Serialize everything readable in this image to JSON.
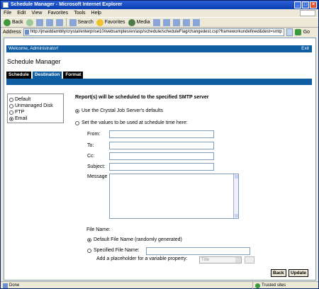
{
  "window": {
    "title": "Schedule Manager - Microsoft Internet Explorer"
  },
  "menu": [
    "File",
    "Edit",
    "View",
    "Favorites",
    "Tools",
    "Help"
  ],
  "toolbar": {
    "back": "Back",
    "search": "Search",
    "favorites": "Favorites",
    "media": "Media"
  },
  "address": {
    "label": "Address",
    "url": "http://jmaiddamblly/crystal/enterprise10/websamples/en/asp/schedule/scheduleFlag/changedest.csp?frameworkundefined&dest=smtp",
    "go": "Go"
  },
  "page": {
    "welcome": "Welcome, Administrator!",
    "exit": "Exit",
    "title": "Schedule Manager",
    "tabs": [
      "Schedule",
      "Destination",
      "Format"
    ]
  },
  "destinations": [
    {
      "label": "Default",
      "selected": false
    },
    {
      "label": "Unmanaged Disk",
      "selected": false
    },
    {
      "label": "FTP",
      "selected": false
    },
    {
      "label": "Email",
      "selected": true
    }
  ],
  "form": {
    "heading": "Report(s) will be scheduled to the specified SMTP server",
    "opt_defaults": "Use the Crystal Job Server's defaults",
    "opt_custom": "Set the values to be used at schedule time here:",
    "from": "From:",
    "to": "To:",
    "cc": "Cc:",
    "subject": "Subject:",
    "message": "Message",
    "file_name": "File Name:",
    "fn_default": "Default File Name (randomly generated)",
    "fn_specified": "Specified File Name:",
    "placeholder_label": "Add a placeholder for a variable property:",
    "placeholder_value": "Title"
  },
  "buttons": {
    "back": "Back",
    "update": "Update"
  },
  "status": {
    "left": "Done",
    "zone": "Trusted sites"
  }
}
